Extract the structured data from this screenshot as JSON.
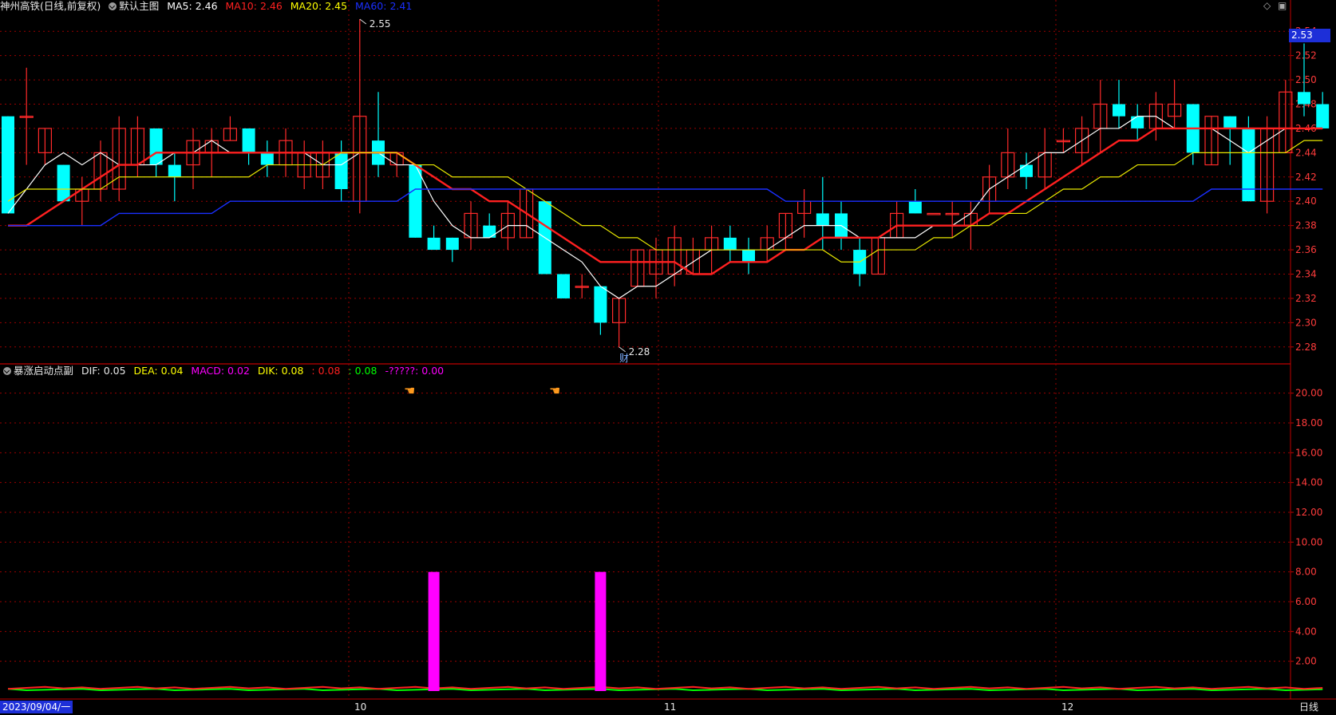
{
  "header": {
    "stock": "神州高铁(日线,前复权)",
    "main_chart": "默认主图",
    "ma": [
      {
        "label": "MA5: 2.46",
        "color": "#ffffff"
      },
      {
        "label": "MA10: 2.46",
        "color": "#ff2020"
      },
      {
        "label": "MA20: 2.45",
        "color": "#ffff00"
      },
      {
        "label": "MA60: 2.41",
        "color": "#1a2fff"
      }
    ]
  },
  "sub_header": {
    "indicator": "暴涨启动点副",
    "items": [
      {
        "label": "DIF: 0.05",
        "color": "#e8e8e8"
      },
      {
        "label": "DEA: 0.04",
        "color": "#ffff00"
      },
      {
        "label": "MACD: 0.02",
        "color": "#ff00ff"
      },
      {
        "label": "DIK: 0.08",
        "color": "#ffff00"
      },
      {
        "label": ": 0.08",
        "color": "#ff2020"
      },
      {
        "label": ": 0.08",
        "color": "#00ff00"
      },
      {
        "label": "-?????: 0.00",
        "color": "#ff00ff"
      }
    ]
  },
  "current_price_tag": "2.53",
  "annotations": {
    "high_label": "2.55",
    "low_label": "2.28",
    "event_badge": "财"
  },
  "bottom_bar": {
    "date": "2023/09/04/一",
    "period": "日线",
    "months": [
      "10",
      "11",
      "12"
    ]
  },
  "icons": [
    "diamond-icon",
    "window-restore-icon",
    "dropdown-icon",
    "hand-pointer-icon"
  ],
  "colors": {
    "up": "#ff2a2a",
    "down": "#00ffff",
    "grid": "#9a0000",
    "border": "#c00000",
    "axis_text": "#ff3b3b"
  },
  "chart_data": [
    {
      "type": "candlestick",
      "title": "神州高铁(日线,前复权)",
      "y_ticks": [
        "2.54",
        "2.52",
        "2.50",
        "2.48",
        "2.46",
        "2.44",
        "2.42",
        "2.40",
        "2.38",
        "2.36",
        "2.34",
        "2.32",
        "2.30",
        "2.28"
      ],
      "ylim": [
        2.27,
        2.55
      ],
      "candles": [
        [
          2.47,
          2.39,
          2.47,
          2.39
        ],
        [
          2.47,
          2.47,
          2.51,
          2.43
        ],
        [
          2.44,
          2.46,
          2.46,
          2.43
        ],
        [
          2.43,
          2.4,
          2.43,
          2.4
        ],
        [
          2.4,
          2.41,
          2.42,
          2.38
        ],
        [
          2.41,
          2.44,
          2.45,
          2.4
        ],
        [
          2.41,
          2.46,
          2.47,
          2.4
        ],
        [
          2.43,
          2.46,
          2.47,
          2.42
        ],
        [
          2.46,
          2.43,
          2.46,
          2.42
        ],
        [
          2.43,
          2.42,
          2.44,
          2.4
        ],
        [
          2.43,
          2.45,
          2.46,
          2.41
        ],
        [
          2.44,
          2.45,
          2.46,
          2.42
        ],
        [
          2.45,
          2.46,
          2.47,
          2.45
        ],
        [
          2.46,
          2.44,
          2.46,
          2.43
        ],
        [
          2.44,
          2.43,
          2.45,
          2.42
        ],
        [
          2.43,
          2.45,
          2.46,
          2.42
        ],
        [
          2.42,
          2.44,
          2.45,
          2.41
        ],
        [
          2.42,
          2.44,
          2.45,
          2.41
        ],
        [
          2.44,
          2.41,
          2.45,
          2.4
        ],
        [
          2.4,
          2.47,
          2.55,
          2.39
        ],
        [
          2.45,
          2.43,
          2.49,
          2.42
        ],
        [
          2.43,
          2.44,
          2.44,
          2.42
        ],
        [
          2.43,
          2.37,
          2.43,
          2.37
        ],
        [
          2.37,
          2.36,
          2.38,
          2.36
        ],
        [
          2.37,
          2.36,
          2.37,
          2.35
        ],
        [
          2.37,
          2.39,
          2.4,
          2.36
        ],
        [
          2.38,
          2.37,
          2.39,
          2.37
        ],
        [
          2.37,
          2.39,
          2.4,
          2.36
        ],
        [
          2.37,
          2.41,
          2.41,
          2.37
        ],
        [
          2.4,
          2.34,
          2.4,
          2.34
        ],
        [
          2.34,
          2.32,
          2.34,
          2.32
        ],
        [
          2.33,
          2.33,
          2.34,
          2.32
        ],
        [
          2.33,
          2.3,
          2.33,
          2.29
        ],
        [
          2.3,
          2.32,
          2.32,
          2.28
        ],
        [
          2.33,
          2.36,
          2.36,
          2.33
        ],
        [
          2.34,
          2.36,
          2.37,
          2.32
        ],
        [
          2.34,
          2.37,
          2.38,
          2.33
        ],
        [
          2.34,
          2.36,
          2.37,
          2.34
        ],
        [
          2.36,
          2.37,
          2.38,
          2.34
        ],
        [
          2.37,
          2.36,
          2.38,
          2.35
        ],
        [
          2.36,
          2.35,
          2.37,
          2.34
        ],
        [
          2.36,
          2.37,
          2.38,
          2.35
        ],
        [
          2.37,
          2.39,
          2.39,
          2.36
        ],
        [
          2.39,
          2.4,
          2.41,
          2.37
        ],
        [
          2.39,
          2.38,
          2.42,
          2.36
        ],
        [
          2.39,
          2.37,
          2.4,
          2.36
        ],
        [
          2.36,
          2.34,
          2.37,
          2.33
        ],
        [
          2.34,
          2.37,
          2.37,
          2.34
        ],
        [
          2.37,
          2.39,
          2.4,
          2.37
        ],
        [
          2.4,
          2.39,
          2.41,
          2.39
        ],
        [
          2.39,
          2.39,
          2.39,
          2.39
        ],
        [
          2.39,
          2.39,
          2.4,
          2.37
        ],
        [
          2.38,
          2.39,
          2.4,
          2.36
        ],
        [
          2.4,
          2.42,
          2.43,
          2.39
        ],
        [
          2.42,
          2.44,
          2.46,
          2.41
        ],
        [
          2.43,
          2.42,
          2.44,
          2.41
        ],
        [
          2.42,
          2.44,
          2.46,
          2.41
        ],
        [
          2.45,
          2.45,
          2.46,
          2.44
        ],
        [
          2.44,
          2.46,
          2.47,
          2.43
        ],
        [
          2.46,
          2.48,
          2.5,
          2.44
        ],
        [
          2.48,
          2.47,
          2.5,
          2.46
        ],
        [
          2.47,
          2.46,
          2.48,
          2.45
        ],
        [
          2.46,
          2.48,
          2.49,
          2.45
        ],
        [
          2.47,
          2.48,
          2.5,
          2.46
        ],
        [
          2.48,
          2.44,
          2.48,
          2.43
        ],
        [
          2.43,
          2.47,
          2.47,
          2.43
        ],
        [
          2.47,
          2.46,
          2.47,
          2.43
        ],
        [
          2.46,
          2.4,
          2.47,
          2.4
        ],
        [
          2.4,
          2.46,
          2.47,
          2.39
        ],
        [
          2.44,
          2.49,
          2.5,
          2.44
        ],
        [
          2.49,
          2.48,
          2.53,
          2.47
        ],
        [
          2.48,
          2.46,
          2.49,
          2.46
        ]
      ],
      "ma_series": [
        {
          "name": "MA5",
          "values": [
            2.39,
            2.41,
            2.43,
            2.44,
            2.43,
            2.44,
            2.43,
            2.43,
            2.43,
            2.44,
            2.44,
            2.45,
            2.44,
            2.44,
            2.44,
            2.44,
            2.44,
            2.43,
            2.43,
            2.44,
            2.44,
            2.43,
            2.43,
            2.4,
            2.38,
            2.37,
            2.37,
            2.38,
            2.38,
            2.37,
            2.36,
            2.35,
            2.33,
            2.32,
            2.33,
            2.33,
            2.34,
            2.35,
            2.36,
            2.36,
            2.36,
            2.36,
            2.37,
            2.38,
            2.38,
            2.38,
            2.37,
            2.37,
            2.37,
            2.37,
            2.38,
            2.38,
            2.39,
            2.41,
            2.42,
            2.43,
            2.44,
            2.44,
            2.45,
            2.46,
            2.46,
            2.47,
            2.47,
            2.46,
            2.46,
            2.46,
            2.45,
            2.44,
            2.45,
            2.46,
            2.46,
            2.46
          ]
        },
        {
          "name": "MA10",
          "values": [
            2.38,
            2.38,
            2.39,
            2.4,
            2.41,
            2.42,
            2.43,
            2.43,
            2.44,
            2.44,
            2.44,
            2.44,
            2.44,
            2.44,
            2.44,
            2.44,
            2.44,
            2.44,
            2.44,
            2.44,
            2.44,
            2.44,
            2.43,
            2.42,
            2.41,
            2.41,
            2.4,
            2.4,
            2.39,
            2.38,
            2.37,
            2.36,
            2.35,
            2.35,
            2.35,
            2.35,
            2.35,
            2.34,
            2.34,
            2.35,
            2.35,
            2.35,
            2.36,
            2.36,
            2.37,
            2.37,
            2.37,
            2.37,
            2.38,
            2.38,
            2.38,
            2.38,
            2.38,
            2.39,
            2.39,
            2.4,
            2.41,
            2.42,
            2.43,
            2.44,
            2.45,
            2.45,
            2.46,
            2.46,
            2.46,
            2.46,
            2.46,
            2.46,
            2.46,
            2.46,
            2.46,
            2.46
          ]
        },
        {
          "name": "MA20",
          "values": [
            2.4,
            2.41,
            2.41,
            2.41,
            2.41,
            2.41,
            2.42,
            2.42,
            2.42,
            2.42,
            2.42,
            2.42,
            2.42,
            2.42,
            2.43,
            2.43,
            2.43,
            2.43,
            2.44,
            2.44,
            2.44,
            2.44,
            2.43,
            2.43,
            2.42,
            2.42,
            2.42,
            2.42,
            2.41,
            2.4,
            2.39,
            2.38,
            2.38,
            2.37,
            2.37,
            2.36,
            2.36,
            2.36,
            2.36,
            2.36,
            2.36,
            2.36,
            2.36,
            2.36,
            2.36,
            2.35,
            2.35,
            2.36,
            2.36,
            2.36,
            2.37,
            2.37,
            2.38,
            2.38,
            2.39,
            2.39,
            2.4,
            2.41,
            2.41,
            2.42,
            2.42,
            2.43,
            2.43,
            2.43,
            2.44,
            2.44,
            2.44,
            2.44,
            2.44,
            2.44,
            2.45,
            2.45
          ]
        },
        {
          "name": "MA60",
          "values": [
            2.38,
            2.38,
            2.38,
            2.38,
            2.38,
            2.38,
            2.39,
            2.39,
            2.39,
            2.39,
            2.39,
            2.39,
            2.4,
            2.4,
            2.4,
            2.4,
            2.4,
            2.4,
            2.4,
            2.4,
            2.4,
            2.4,
            2.41,
            2.41,
            2.41,
            2.41,
            2.41,
            2.41,
            2.41,
            2.41,
            2.41,
            2.41,
            2.41,
            2.41,
            2.41,
            2.41,
            2.41,
            2.41,
            2.41,
            2.41,
            2.41,
            2.41,
            2.4,
            2.4,
            2.4,
            2.4,
            2.4,
            2.4,
            2.4,
            2.4,
            2.4,
            2.4,
            2.4,
            2.4,
            2.4,
            2.4,
            2.4,
            2.4,
            2.4,
            2.4,
            2.4,
            2.4,
            2.4,
            2.4,
            2.4,
            2.41,
            2.41,
            2.41,
            2.41,
            2.41,
            2.41,
            2.41
          ]
        }
      ]
    },
    {
      "type": "bar",
      "title": "暴涨启动点副",
      "y_ticks": [
        "20.00",
        "18.00",
        "16.00",
        "14.00",
        "12.00",
        "10.00",
        "8.00",
        "6.00",
        "4.00",
        "2.00"
      ],
      "ylim": [
        0,
        21
      ],
      "spikes": [
        {
          "index": 23,
          "value": 8
        },
        {
          "index": 32,
          "value": 8
        }
      ]
    }
  ]
}
